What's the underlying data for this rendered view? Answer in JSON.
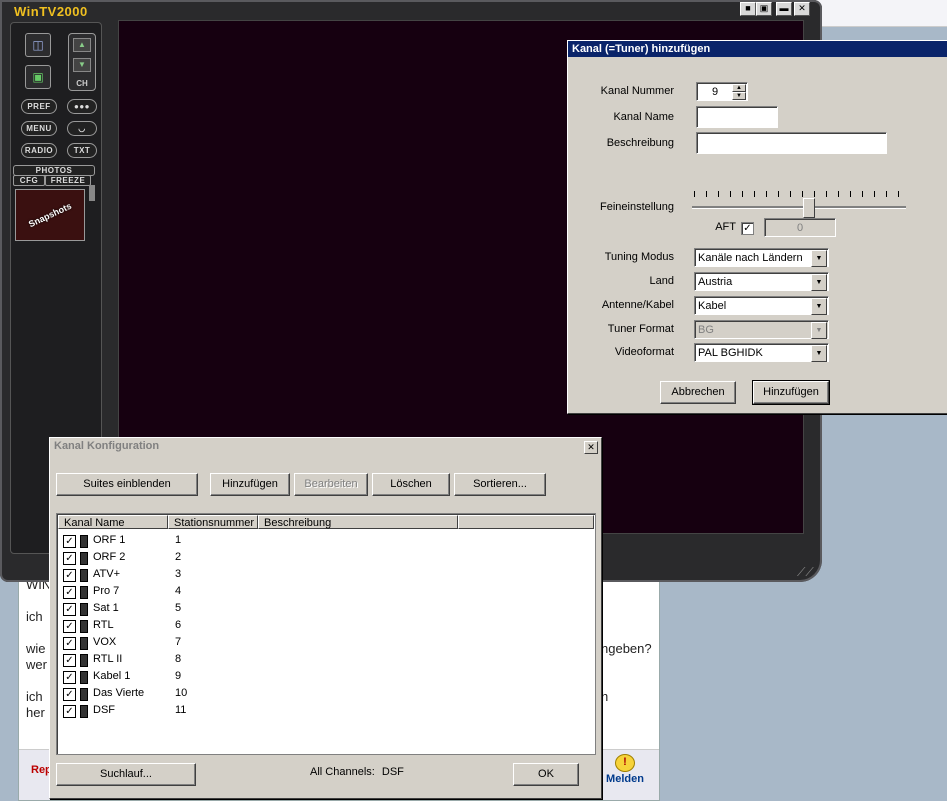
{
  "background_page": {
    "lines_left": [
      "WIN",
      "ich",
      "wie",
      "wer",
      "ich",
      "her"
    ],
    "lines_right": [
      "ngeben?",
      "h"
    ],
    "reply_label": "Rep",
    "report_label": "Melden",
    "report_icon": "exclamation-icon"
  },
  "wintv": {
    "title": "WinTV2000",
    "window_buttons": [
      "■",
      "▣",
      "▬",
      "✕"
    ],
    "left_panel": {
      "ch_label": "CH",
      "buttons": [
        "PREF",
        "MENU",
        "RADIO",
        "TXT"
      ],
      "photos_label": "PHOTOS",
      "cfg_label": "CFG",
      "freeze_label": "FREEZE",
      "snapshot_label": "Snapshots"
    }
  },
  "add_channel_dialog": {
    "title": "Kanal (=Tuner) hinzufügen",
    "fields": {
      "kanal_nummer_label": "Kanal Nummer",
      "kanal_nummer_value": "9",
      "kanal_name_label": "Kanal Name",
      "kanal_name_value": "",
      "beschreibung_label": "Beschreibung",
      "beschreibung_value": "",
      "feineinstellung_label": "Feineinstellung",
      "feineinstellung_level": 0.55,
      "aft_label": "AFT",
      "aft_checked": true,
      "aft_value": "0",
      "tuning_modus_label": "Tuning Modus",
      "tuning_modus_value": "Kanäle nach Ländern",
      "land_label": "Land",
      "land_value": "Austria",
      "antenne_label": "Antenne/Kabel",
      "antenne_value": "Kabel",
      "tuner_format_label": "Tuner Format",
      "tuner_format_value": "BG",
      "videoformat_label": "Videoformat",
      "videoformat_value": "PAL BGHIDK"
    },
    "buttons": {
      "cancel": "Abbrechen",
      "add": "Hinzufügen"
    }
  },
  "config_dialog": {
    "title": "Kanal Konfiguration",
    "toolbar": {
      "show_suites": "Suites einblenden",
      "add": "Hinzufügen",
      "edit": "Bearbeiten",
      "delete": "Löschen",
      "sort": "Sortieren..."
    },
    "columns": [
      "Kanal Name",
      "Stationsnummer",
      "Beschreibung",
      ""
    ],
    "channels": [
      {
        "name": "ORF 1",
        "number": "1",
        "checked": true
      },
      {
        "name": "ORF 2",
        "number": "2",
        "checked": true
      },
      {
        "name": "ATV+",
        "number": "3",
        "checked": true
      },
      {
        "name": "Pro 7",
        "number": "4",
        "checked": true
      },
      {
        "name": "Sat 1",
        "number": "5",
        "checked": true
      },
      {
        "name": "RTL",
        "number": "6",
        "checked": true
      },
      {
        "name": "VOX",
        "number": "7",
        "checked": true
      },
      {
        "name": "RTL II",
        "number": "8",
        "checked": true
      },
      {
        "name": "Kabel 1",
        "number": "9",
        "checked": true
      },
      {
        "name": "Das Vierte",
        "number": "10",
        "checked": true
      },
      {
        "name": "DSF",
        "number": "11",
        "checked": true
      }
    ],
    "scan_button": "Suchlauf...",
    "all_channels_label": "All Channels:",
    "all_channels_value": "DSF",
    "ok_button": "OK"
  },
  "colors": {
    "title_active": "#0a246a",
    "dialog_face": "#d4d0c8",
    "wintv_title": "#f0c020",
    "video_bg": "#160010"
  }
}
